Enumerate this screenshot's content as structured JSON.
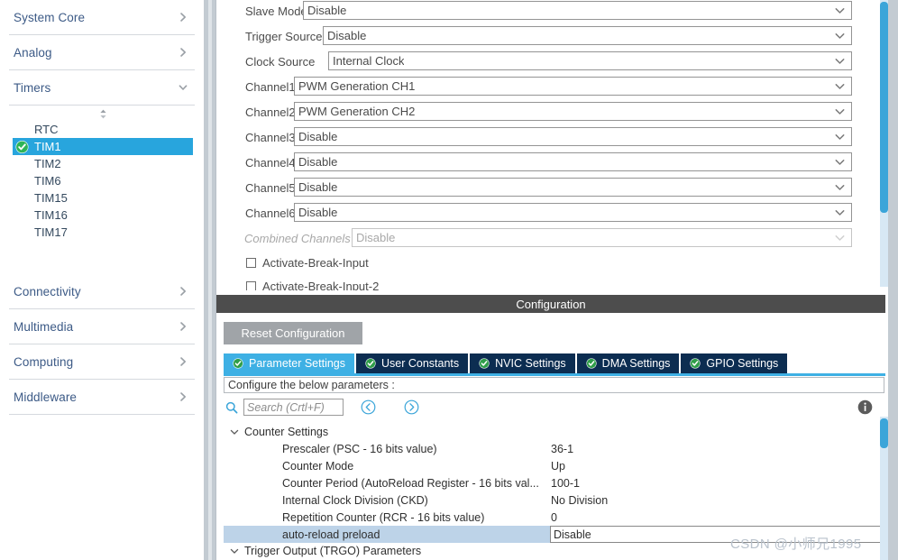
{
  "sidebar": {
    "categories": [
      {
        "label": "System Core",
        "icon": "chevron-right-icon",
        "expanded": false
      },
      {
        "label": "Analog",
        "icon": "chevron-right-icon",
        "expanded": false
      },
      {
        "label": "Timers",
        "icon": "chevron-down-icon",
        "expanded": true
      }
    ],
    "categories_bottom": [
      {
        "label": "Connectivity",
        "icon": "chevron-right-icon",
        "expanded": false
      },
      {
        "label": "Multimedia",
        "icon": "chevron-right-icon",
        "expanded": false
      },
      {
        "label": "Computing",
        "icon": "chevron-right-icon",
        "expanded": false
      },
      {
        "label": "Middleware",
        "icon": "chevron-right-icon",
        "expanded": false
      }
    ],
    "timers": [
      {
        "label": "RTC",
        "selected": false,
        "configured": false
      },
      {
        "label": "TIM1",
        "selected": true,
        "configured": true
      },
      {
        "label": "TIM2",
        "selected": false,
        "configured": false
      },
      {
        "label": "TIM6",
        "selected": false,
        "configured": false
      },
      {
        "label": "TIM15",
        "selected": false,
        "configured": false
      },
      {
        "label": "TIM16",
        "selected": false,
        "configured": false
      },
      {
        "label": "TIM17",
        "selected": false,
        "configured": false
      }
    ],
    "selected_color": "#28a5dd",
    "label_color": "#3c5a86"
  },
  "mode_panel": {
    "rows": [
      {
        "label": "Slave Mode",
        "value": "Disable",
        "disabled": false
      },
      {
        "label": "Trigger Source",
        "value": "Disable",
        "disabled": false
      },
      {
        "label": "Clock Source",
        "value": "Internal Clock",
        "disabled": false
      },
      {
        "label": "Channel1",
        "value": "PWM Generation CH1",
        "disabled": false
      },
      {
        "label": "Channel2",
        "value": "PWM Generation CH2",
        "disabled": false
      },
      {
        "label": "Channel3",
        "value": "Disable",
        "disabled": false
      },
      {
        "label": "Channel4",
        "value": "Disable",
        "disabled": false
      },
      {
        "label": "Channel5",
        "value": "Disable",
        "disabled": false
      },
      {
        "label": "Channel6",
        "value": "Disable",
        "disabled": false
      },
      {
        "label": "Combined Channels",
        "value": "Disable",
        "disabled": true
      }
    ],
    "checkboxes": [
      {
        "label": "Activate-Break-Input",
        "checked": false
      },
      {
        "label": "Activate-Break-Input-2",
        "checked": false
      }
    ],
    "scrollbar_color": "#3ba5d9"
  },
  "config": {
    "title": "Configuration",
    "reset_label": "Reset Configuration",
    "tabs": [
      {
        "label": "Parameter Settings",
        "active": true,
        "icon": "check-circle-icon"
      },
      {
        "label": "User Constants",
        "active": false,
        "icon": "check-circle-icon"
      },
      {
        "label": "NVIC Settings",
        "active": false,
        "icon": "check-circle-icon"
      },
      {
        "label": "DMA Settings",
        "active": false,
        "icon": "check-circle-icon"
      },
      {
        "label": "GPIO Settings",
        "active": false,
        "icon": "check-circle-icon"
      }
    ],
    "note": "Configure the below parameters :",
    "search": {
      "value": "",
      "placeholder": "Search (Crtl+F)"
    },
    "active_tab_color": "#3eb0e4",
    "tab_color": "#0c2d51"
  },
  "parameters": {
    "groups": [
      {
        "name": "Counter Settings",
        "expanded": true,
        "rows": [
          {
            "name": "Prescaler (PSC - 16 bits value)",
            "value": "36-1",
            "selected": false,
            "editing": false
          },
          {
            "name": "Counter Mode",
            "value": "Up",
            "selected": false,
            "editing": false
          },
          {
            "name": "Counter Period (AutoReload Register - 16 bits val...",
            "value": "100-1",
            "selected": false,
            "editing": false
          },
          {
            "name": "Internal Clock Division (CKD)",
            "value": "No Division",
            "selected": false,
            "editing": false
          },
          {
            "name": "Repetition Counter (RCR - 16 bits value)",
            "value": "0",
            "selected": false,
            "editing": false
          },
          {
            "name": "auto-reload preload",
            "value": "Disable",
            "selected": true,
            "editing": true
          }
        ]
      },
      {
        "name": "Trigger Output (TRGO) Parameters",
        "expanded": true,
        "rows": []
      }
    ]
  },
  "watermark": "CSDN @小师兄1995"
}
